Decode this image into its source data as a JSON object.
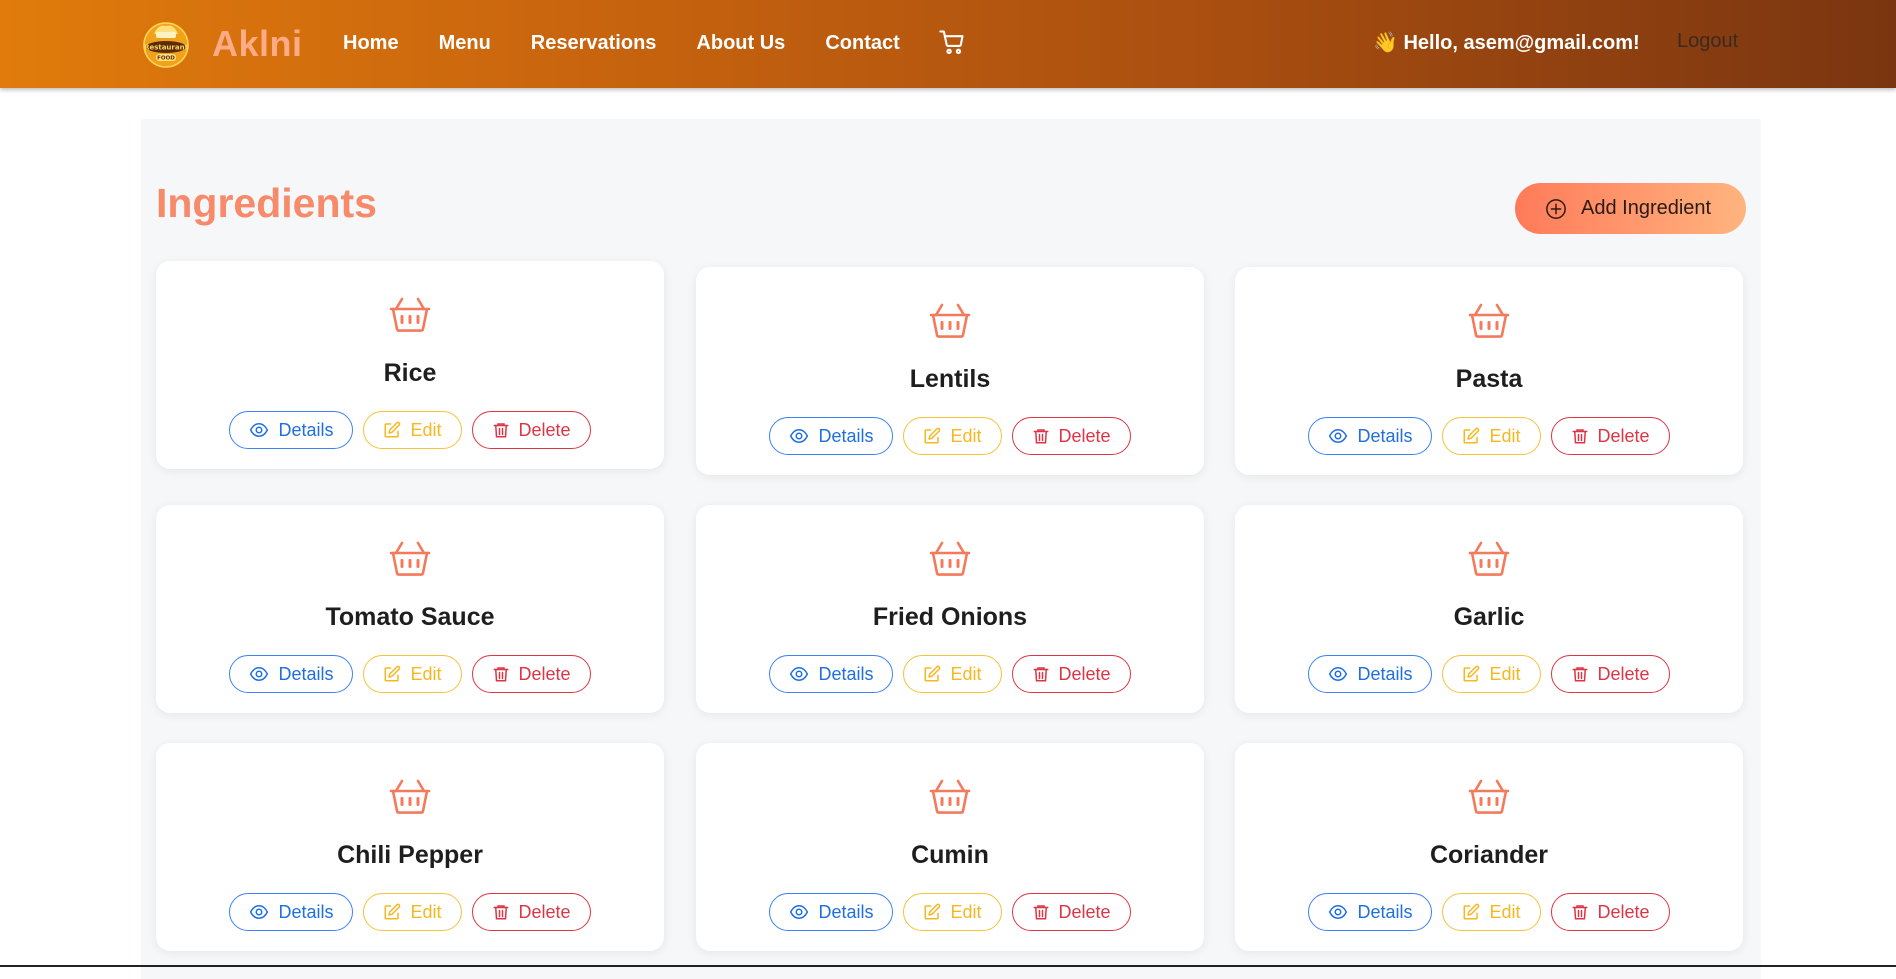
{
  "navbar": {
    "brand": "Aklni",
    "logo_text_top": "Restaurant",
    "logo_text_bottom": "FOOD",
    "links": [
      "Home",
      "Menu",
      "Reservations",
      "About Us",
      "Contact"
    ],
    "cart_icon": "cart-icon",
    "greeting": "👋 Hello, asem@gmail.com!",
    "logout": "Logout"
  },
  "page": {
    "title": "Ingredients",
    "add_button": "Add Ingredient"
  },
  "card_buttons": {
    "details": "Details",
    "edit": "Edit",
    "delete": "Delete"
  },
  "ingredients": [
    "Rice",
    "Lentils",
    "Pasta",
    "Tomato Sauce",
    "Fried Onions",
    "Garlic",
    "Chili Pepper",
    "Cumin",
    "Coriander"
  ],
  "colors": {
    "accent": "#f68a6a",
    "details": "#1f6fe0",
    "edit": "#f5b820",
    "delete": "#dc3545"
  }
}
